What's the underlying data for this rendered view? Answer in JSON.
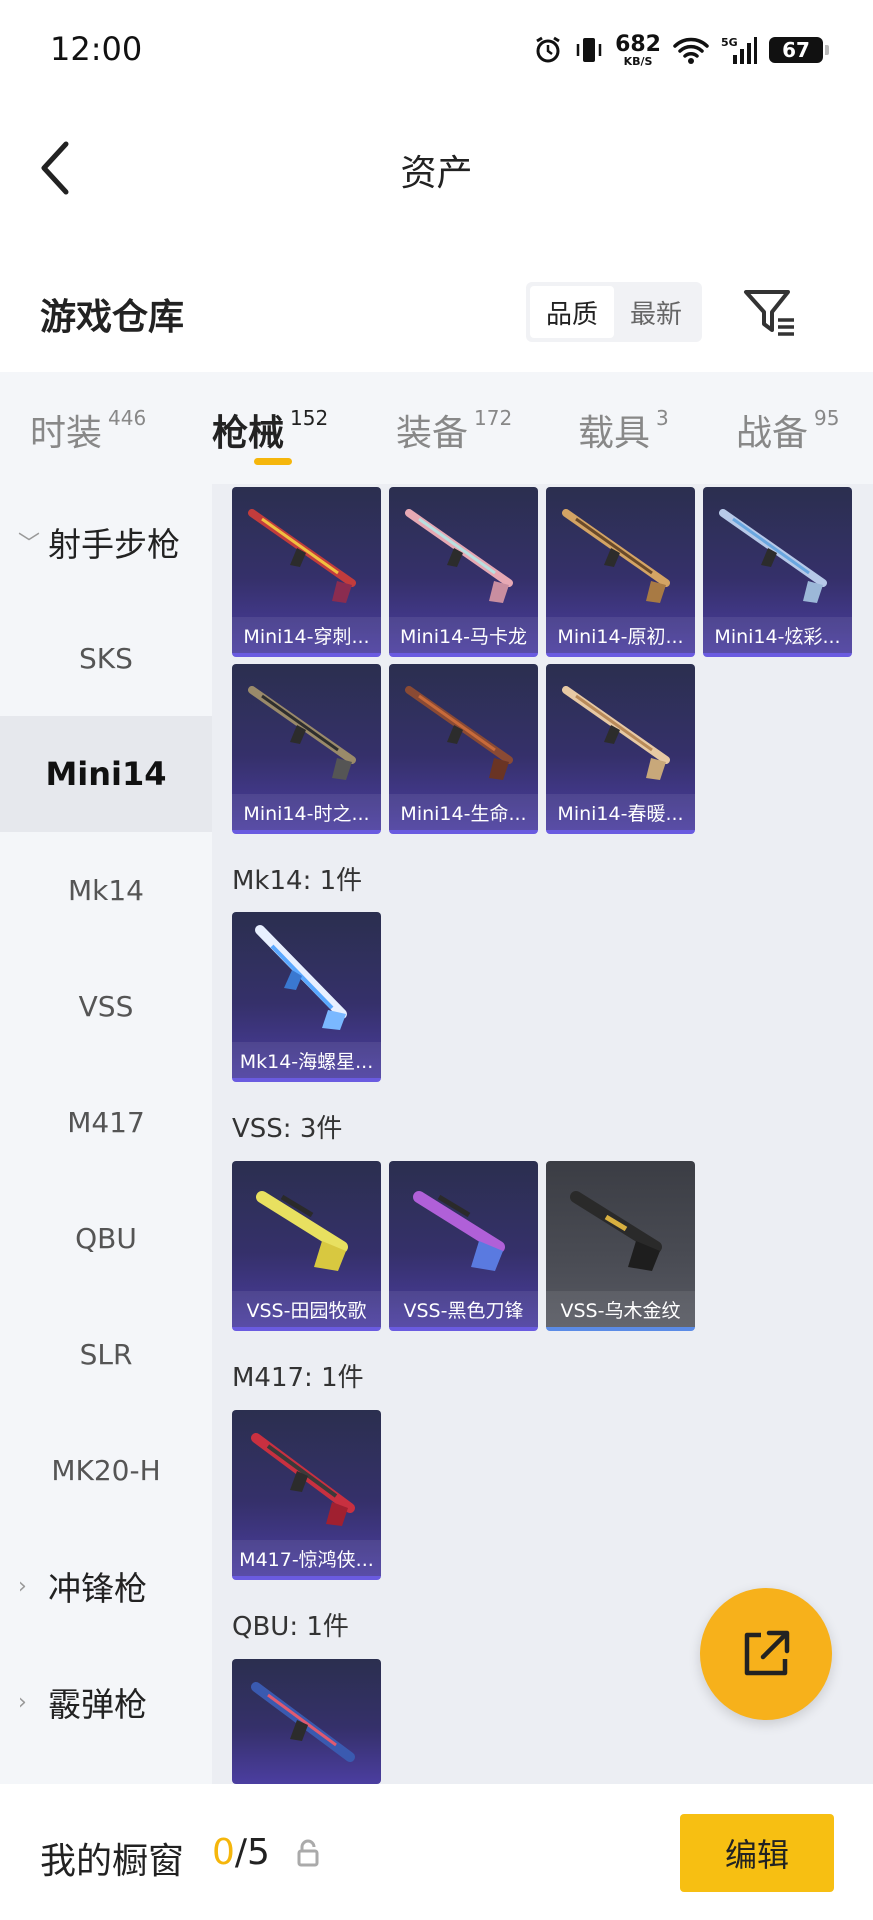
{
  "status": {
    "time": "12:00",
    "speed_value": "682",
    "speed_unit": "KB/S",
    "network": "5G",
    "battery": "67"
  },
  "header": {
    "title": "资产"
  },
  "warehouse": {
    "title": "游戏仓库",
    "sort_options": [
      "品质",
      "最新"
    ],
    "sort_selected": "品质"
  },
  "tabs": [
    {
      "label": "时装",
      "count": "446"
    },
    {
      "label": "枪械",
      "count": "152"
    },
    {
      "label": "装备",
      "count": "172"
    },
    {
      "label": "载具",
      "count": "3"
    },
    {
      "label": "战备",
      "count": "95"
    }
  ],
  "sidebar": {
    "groups": [
      {
        "label": "射手步枪",
        "expanded": true
      },
      {
        "label": "冲锋枪",
        "expanded": false
      },
      {
        "label": "霰弹枪",
        "expanded": false
      }
    ],
    "items": [
      "SKS",
      "Mini14",
      "Mk14",
      "VSS",
      "M417",
      "QBU",
      "SLR",
      "MK20-H"
    ],
    "active": "Mini14"
  },
  "content": {
    "mini14_cards": [
      "Mini14-穿刺...",
      "Mini14-马卡龙",
      "Mini14-原初...",
      "Mini14-炫彩...",
      "Mini14-时之...",
      "Mini14-生命...",
      "Mini14-春暖..."
    ],
    "mk14_title": "Mk14: 1件",
    "mk14_cards": [
      "Mk14-海螺星..."
    ],
    "vss_title": "VSS: 3件",
    "vss_cards": [
      "VSS-田园牧歌",
      "VSS-黑色刀锋",
      "VSS-乌木金纹"
    ],
    "m417_title": "M417: 1件",
    "m417_cards": [
      "M417-惊鸿侠..."
    ],
    "qbu_title": "QBU: 1件"
  },
  "bottom": {
    "showcase_label": "我的橱窗",
    "showcase_current": "0",
    "showcase_total": "/5",
    "edit_label": "编辑"
  },
  "colors": {
    "accent": "#f5b60c",
    "card_purple": "#35306a",
    "card_gray": "#4a4c54"
  }
}
